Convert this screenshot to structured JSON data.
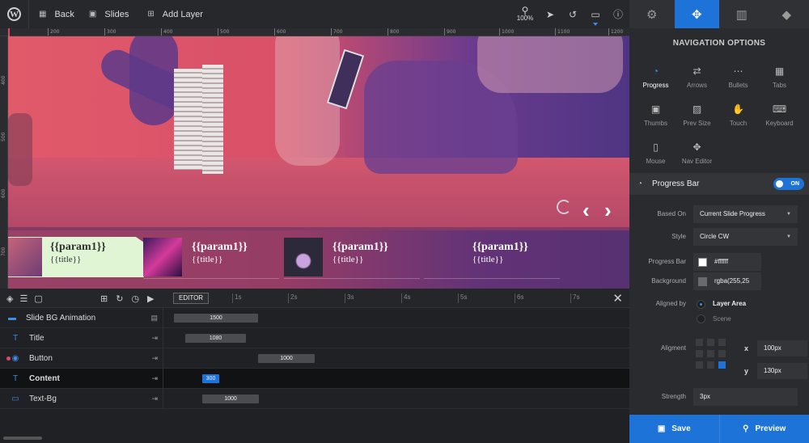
{
  "topbar": {
    "back_label": "Back",
    "slides_label": "Slides",
    "add_layer_label": "Add Layer",
    "zoom_label": "100%"
  },
  "ruler": {
    "top_ticks": [
      "200",
      "300",
      "400",
      "500",
      "600",
      "700",
      "800",
      "900",
      "1000",
      "1100",
      "1200"
    ],
    "left_ticks": [
      "400",
      "500",
      "600",
      "700"
    ]
  },
  "slider": {
    "thumbnails": [
      {
        "param": "{{param1}}",
        "title": "{{title}}",
        "active": true
      },
      {
        "param": "{{param1}}",
        "title": "{{title}}",
        "active": false
      },
      {
        "param": "{{param1}}",
        "title": "{{title}}",
        "active": false
      },
      {
        "param": "{{param1}}",
        "title": "{{title}}",
        "active": false
      }
    ]
  },
  "timeline": {
    "editor_label": "EDITOR",
    "ticks": [
      "1s",
      "2s",
      "3s",
      "4s",
      "5s",
      "6s",
      "7s"
    ],
    "rows": [
      {
        "name": "Slide BG Animation",
        "duration": "1500"
      },
      {
        "name": "Title",
        "duration": "1080"
      },
      {
        "name": "Button",
        "duration": "1000"
      },
      {
        "name": "Content",
        "duration": "300"
      },
      {
        "name": "Text-Bg",
        "duration": "1000"
      }
    ]
  },
  "panel": {
    "title": "NAVIGATION OPTIONS",
    "nav_options": [
      {
        "label": "Progress",
        "icon": "progress-icon"
      },
      {
        "label": "Arrows",
        "icon": "arrows-icon"
      },
      {
        "label": "Bullets",
        "icon": "bullets-icon"
      },
      {
        "label": "Tabs",
        "icon": "tabs-icon"
      },
      {
        "label": "Thumbs",
        "icon": "thumbs-icon"
      },
      {
        "label": "Prev Size",
        "icon": "prev-size-icon"
      },
      {
        "label": "Touch",
        "icon": "touch-icon"
      },
      {
        "label": "Keyboard",
        "icon": "keyboard-icon"
      },
      {
        "label": "Mouse",
        "icon": "mouse-icon"
      },
      {
        "label": "Nav Editor",
        "icon": "nav-editor-icon"
      }
    ],
    "progress_bar": {
      "label": "Progress Bar",
      "toggle": "ON",
      "based_on_label": "Based On",
      "based_on_value": "Current Slide Progress",
      "style_label": "Style",
      "style_value": "Circle CW",
      "progress_bar_color_label": "Progress Bar",
      "progress_bar_color_value": "#ffffff",
      "background_label": "Background",
      "background_value": "rgba(255,25",
      "aligned_by_label": "Aligned by",
      "aligned_option_1": "Layer Area",
      "aligned_option_2": "Scene",
      "alignment_label": "Aligment",
      "x_value": "100px",
      "y_value": "130px",
      "strength_label": "Strength",
      "strength_value": "3px"
    },
    "save_label": "Save",
    "preview_label": "Preview"
  },
  "colors": {
    "accent": "#1e73d8",
    "marker": "#e0476d"
  }
}
